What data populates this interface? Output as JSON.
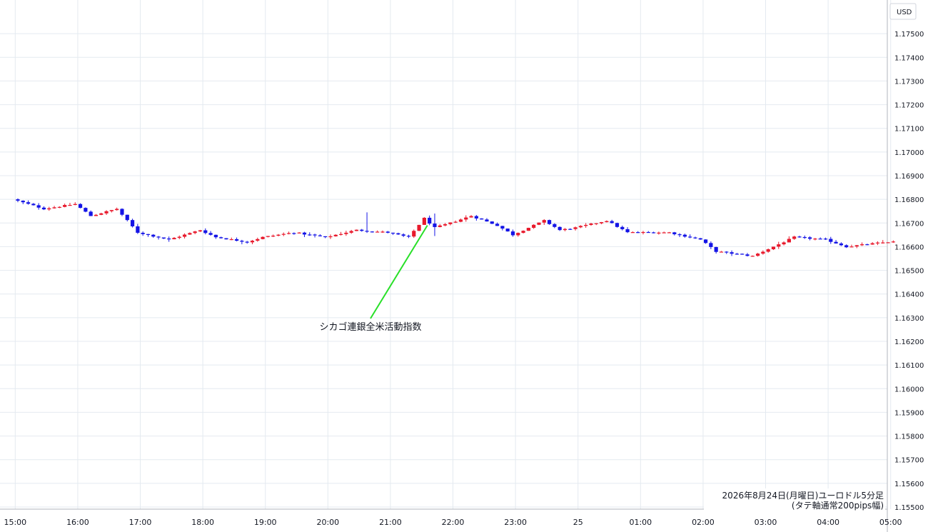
{
  "chart_data": {
    "type": "candlestick",
    "currency_label": "USD",
    "ylim": [
      1.155,
      1.176
    ],
    "y_ticks": [
      "1.17500",
      "1.17400",
      "1.17300",
      "1.17200",
      "1.17100",
      "1.17000",
      "1.16900",
      "1.16800",
      "1.16700",
      "1.16600",
      "1.16500",
      "1.16400",
      "1.16300",
      "1.16200",
      "1.16100",
      "1.16000",
      "1.15900",
      "1.15800",
      "1.15700",
      "1.15600",
      "1.15500"
    ],
    "x_ticks": [
      "15:00",
      "16:00",
      "17:00",
      "18:00",
      "19:00",
      "20:00",
      "21:00",
      "22:00",
      "23:00",
      "25",
      "01:00",
      "02:00",
      "03:00",
      "04:00",
      "05:00"
    ],
    "caption_line1": "2026年8月24日(月曜日)ユーロドル5分足",
    "caption_line2": "(タテ軸通常200pips幅)",
    "annotation": {
      "label": "シカゴ連銀全米活動指数",
      "time": "21:30"
    },
    "colors": {
      "up": "#e8192c",
      "down": "#1414e6",
      "annotation_line": "#28e028",
      "grid": "#e4eaf0"
    },
    "close_path": [
      [
        "15:00",
        1.168
      ],
      [
        "15:30",
        1.1676
      ],
      [
        "16:00",
        1.1678
      ],
      [
        "16:15",
        1.1673
      ],
      [
        "16:40",
        1.1676
      ],
      [
        "17:00",
        1.1666
      ],
      [
        "17:30",
        1.1663
      ],
      [
        "18:00",
        1.1667
      ],
      [
        "18:15",
        1.1664
      ],
      [
        "18:45",
        1.1662
      ],
      [
        "19:00",
        1.1664
      ],
      [
        "19:30",
        1.1666
      ],
      [
        "20:00",
        1.1664
      ],
      [
        "20:30",
        1.1667
      ],
      [
        "21:00",
        1.1666
      ],
      [
        "21:20",
        1.1664
      ],
      [
        "21:35",
        1.1672
      ],
      [
        "21:45",
        1.1668
      ],
      [
        "22:00",
        1.167
      ],
      [
        "22:20",
        1.1673
      ],
      [
        "22:45",
        1.1669
      ],
      [
        "23:00",
        1.1665
      ],
      [
        "23:30",
        1.1671
      ],
      [
        "23:45",
        1.1667
      ],
      [
        "00:00",
        1.1668
      ],
      [
        "00:30",
        1.1671
      ],
      [
        "00:50",
        1.1666
      ],
      [
        "01:00",
        1.1666
      ],
      [
        "01:30",
        1.1666
      ],
      [
        "02:00",
        1.1663
      ],
      [
        "02:15",
        1.1658
      ],
      [
        "02:50",
        1.1656
      ],
      [
        "03:15",
        1.1661
      ],
      [
        "03:30",
        1.1664
      ],
      [
        "04:00",
        1.1663
      ],
      [
        "04:20",
        1.166
      ],
      [
        "05:00",
        1.1662
      ]
    ]
  }
}
